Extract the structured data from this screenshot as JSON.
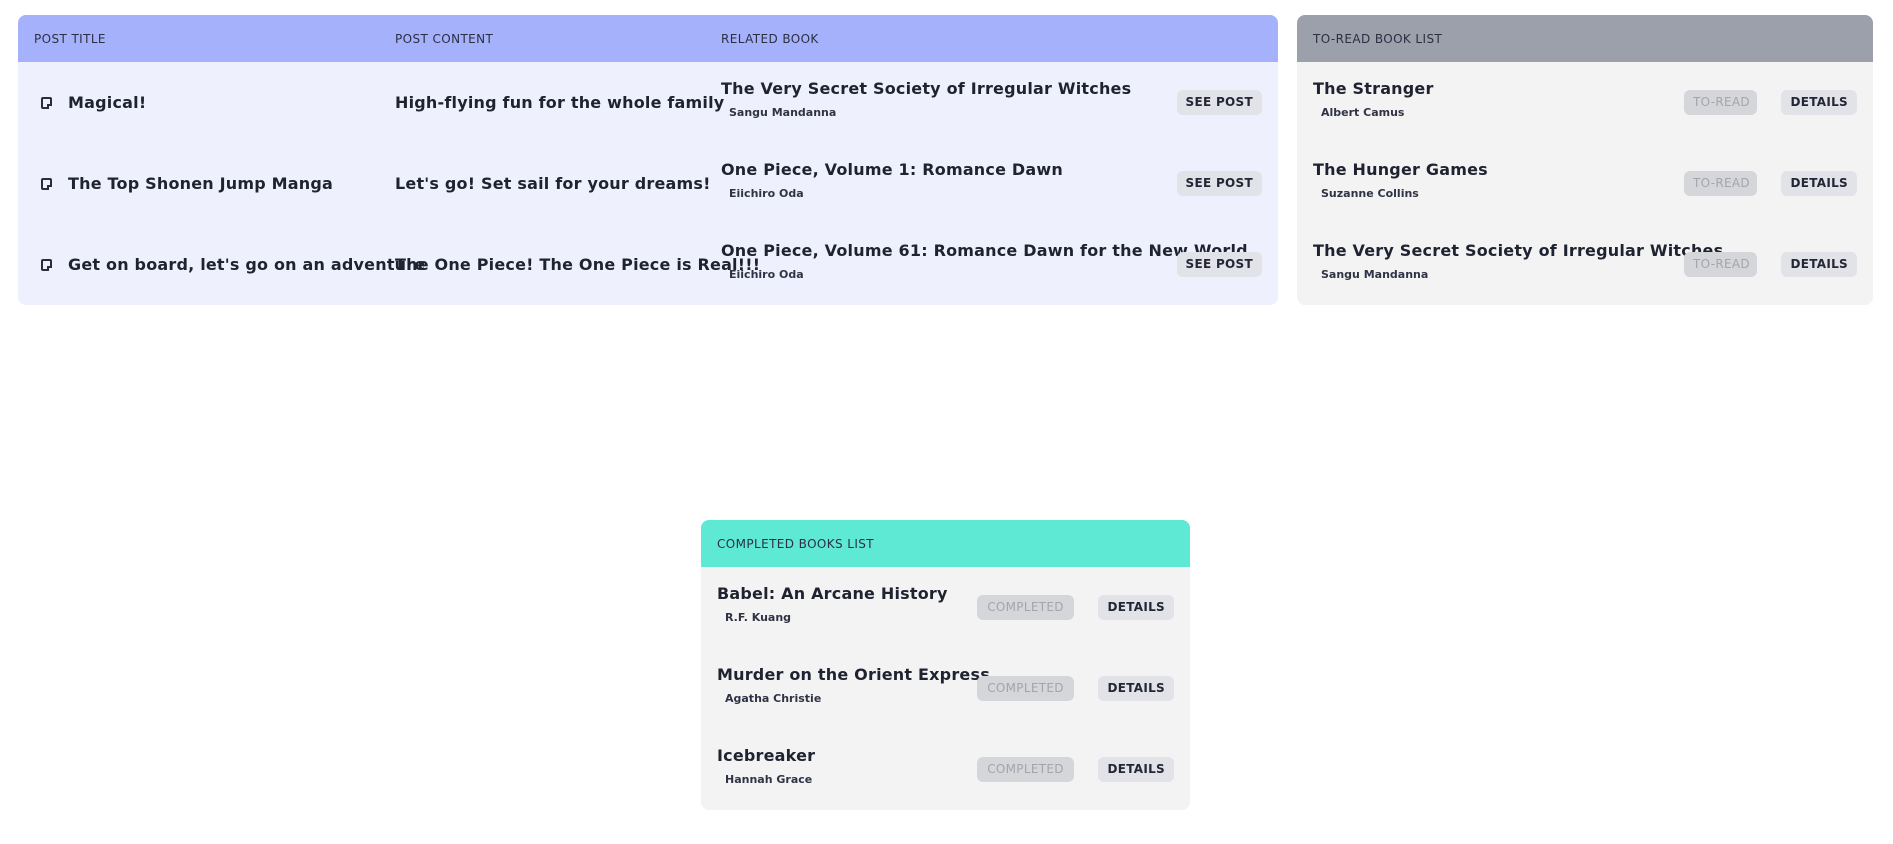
{
  "posts": {
    "headers": {
      "title": "POST TITLE",
      "content": "POST CONTENT",
      "book": "RELATED BOOK"
    },
    "rows": [
      {
        "title": "Magical!",
        "content": "High-flying fun for the whole family",
        "book_title": "The Very Secret Society of Irregular Witches",
        "book_author": "Sangu Mandanna",
        "action": "SEE POST"
      },
      {
        "title": "The Top Shonen Jump Manga",
        "content": "Let's go! Set sail for your dreams!",
        "book_title": "One Piece, Volume 1: Romance Dawn",
        "book_author": "Eiichiro Oda",
        "action": "SEE POST"
      },
      {
        "title": "Get on board, let's go on an adventure",
        "content": "The One Piece! The One Piece is Real!!!",
        "book_title": "One Piece, Volume 61: Romance Dawn for the New World",
        "book_author": "Eiichiro Oda",
        "action": "SEE POST"
      }
    ]
  },
  "to_read": {
    "header": "TO-READ BOOK LIST",
    "items": [
      {
        "title": "The Stranger",
        "author": "Albert Camus",
        "status": "TO-READ",
        "action": "DETAILS"
      },
      {
        "title": "The Hunger Games",
        "author": "Suzanne Collins",
        "status": "TO-READ",
        "action": "DETAILS"
      },
      {
        "title": "The Very Secret Society of Irregular Witches",
        "author": "Sangu Mandanna",
        "status": "TO-READ",
        "action": "DETAILS"
      }
    ]
  },
  "completed": {
    "header": "COMPLETED BOOKS LIST",
    "items": [
      {
        "title": "Babel: An Arcane History",
        "author": "R.F. Kuang",
        "status": "COMPLETED",
        "action": "DETAILS"
      },
      {
        "title": "Murder on the Orient Express",
        "author": "Agatha Christie",
        "status": "COMPLETED",
        "action": "DETAILS"
      },
      {
        "title": "Icebreaker",
        "author": "Hannah Grace",
        "status": "COMPLETED",
        "action": "DETAILS"
      }
    ]
  },
  "colors": {
    "posts_header": "#a5b2fb",
    "posts_body": "#eef1fd",
    "toread_header": "#9ca0aa",
    "completed_header": "#5ee9d5",
    "list_body": "#f3f3f3",
    "button_bg": "#e2e3e8",
    "disabled_button_bg": "#d5d6da"
  },
  "icons": {
    "post": "note-icon"
  }
}
